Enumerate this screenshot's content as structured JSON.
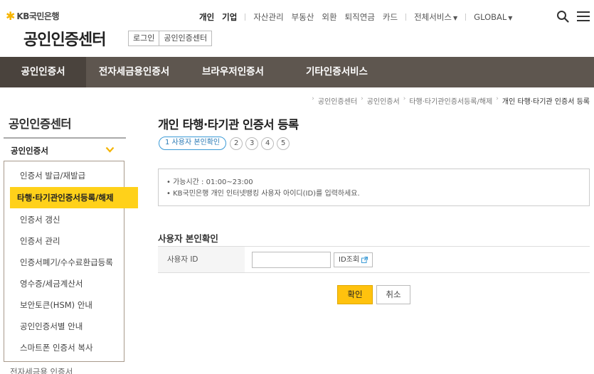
{
  "brand": {
    "logo_text": "KB국민은행",
    "site_title": "공인인증센터",
    "title_buttons": [
      "로그인",
      "공인인증센터"
    ]
  },
  "gnb": {
    "items": [
      "개인",
      "기업",
      "자산관리",
      "부동산",
      "외환",
      "퇴직연금",
      "카드",
      "전체서비스",
      "GLOBAL"
    ]
  },
  "main_nav": {
    "tabs": [
      "공인인증서",
      "전자세금용인증서",
      "브라우저인증서",
      "기타인증서비스"
    ]
  },
  "breadcrumb": [
    "공인인증센터",
    "공인인증서",
    "타행·타기관인증서등록/해제",
    "개인 타행·타기관 인증서 등록"
  ],
  "sidebar": {
    "title": "공인인증센터",
    "group_label": "공인인증서",
    "items": [
      "인증서 발급/재발급",
      "타행·타기관인증서등록/해제",
      "인증서 갱신",
      "인증서 관리",
      "인증서폐기/수수료환급등록",
      "영수증/세금계산서",
      "보안토큰(HSM) 안내",
      "공인인증서별 안내",
      "스마트폰 인증서 복사"
    ],
    "next_group": "전자세금용 인증서"
  },
  "content": {
    "title": "개인 타행·타기관 인증서 등록",
    "step_current": "1 사용자 본인확인",
    "steps": [
      "2",
      "3",
      "4",
      "5"
    ],
    "info_lines": [
      "• 가능시간 : 01:00~23:00",
      "• KB국민은행 개인 인터넷뱅킹 사용자 아이디(ID)를 입력하세요."
    ],
    "section_title": "사용자 본인확인",
    "form": {
      "label": "사용자 ID",
      "input_value": "",
      "lookup_button": "ID조회"
    },
    "confirm_button": "확인",
    "cancel_button": "취소"
  },
  "colors": {
    "nav_bg": "#5e564f",
    "accent_yellow": "#ffc20e",
    "step_blue": "#3a9ad6"
  }
}
